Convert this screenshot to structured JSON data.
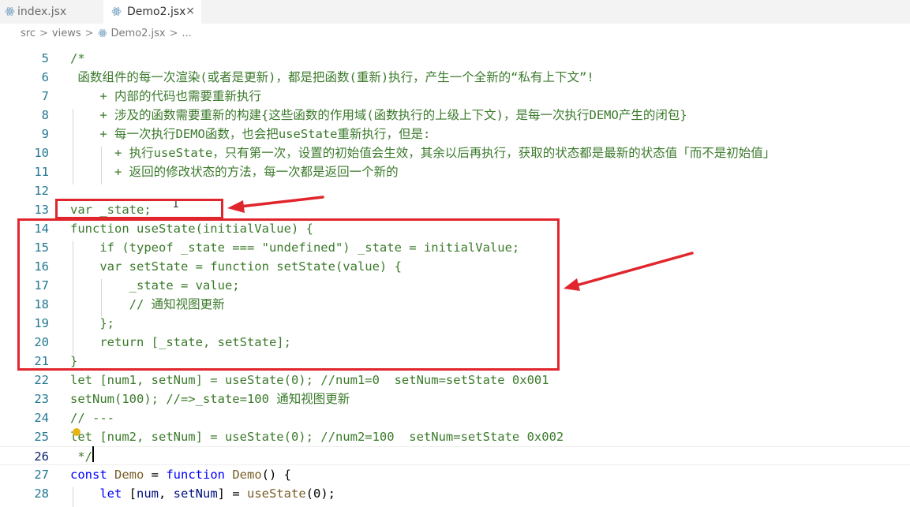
{
  "tabs": [
    {
      "label": "index.jsx",
      "active": false
    },
    {
      "label": "Demo2.jsx",
      "active": true,
      "close": "×"
    }
  ],
  "breadcrumb": {
    "items": [
      "src",
      "views",
      "Demo2.jsx",
      "..."
    ],
    "separator": ">"
  },
  "lines": [
    {
      "num": "5",
      "text": "/*"
    },
    {
      "num": "6",
      "text": " 函数组件的每一次渲染(或者是更新)，都是把函数(重新)执行，产生一个全新的“私有上下文”!"
    },
    {
      "num": "7",
      "text": "    + 内部的代码也需要重新执行"
    },
    {
      "num": "8",
      "text": "    + 涉及的函数需要重新的构建{这些函数的作用域(函数执行的上级上下文)，是每一次执行DEMO产生的闭包}"
    },
    {
      "num": "9",
      "text": "    + 每一次执行DEMO函数，也会把useState重新执行，但是:"
    },
    {
      "num": "10",
      "text": "      + 执行useState，只有第一次，设置的初始值会生效，其余以后再执行，获取的状态都是最新的状态值「而不是初始值」"
    },
    {
      "num": "11",
      "text": "      + 返回的修改状态的方法，每一次都是返回一个新的"
    },
    {
      "num": "12",
      "text": ""
    },
    {
      "num": "13",
      "text": "var _state;"
    },
    {
      "num": "14",
      "text": "function useState(initialValue) {"
    },
    {
      "num": "15",
      "text": "    if (typeof _state === \"undefined\") _state = initialValue;"
    },
    {
      "num": "16",
      "text": "    var setState = function setState(value) {"
    },
    {
      "num": "17",
      "text": "        _state = value;"
    },
    {
      "num": "18",
      "text": "        // 通知视图更新"
    },
    {
      "num": "19",
      "text": "    };"
    },
    {
      "num": "20",
      "text": "    return [_state, setState];"
    },
    {
      "num": "21",
      "text": "}"
    },
    {
      "num": "22",
      "text": "let [num1, setNum] = useState(0); //num1=0  setNum=setState 0x001"
    },
    {
      "num": "23",
      "text": "setNum(100); //=>_state=100 通知视图更新"
    },
    {
      "num": "24",
      "text": "// ---"
    },
    {
      "num": "25",
      "text": "let [num2, setNum] = useState(0); //num2=100  setNum=setState 0x002"
    },
    {
      "num": "26",
      "text": " */"
    }
  ],
  "line27": {
    "num": "27",
    "kw1": "const",
    "name": " Demo",
    "eq": " = ",
    "kw2": "function",
    "fn": " Demo",
    "rest": "() {"
  },
  "line28": {
    "num": "28",
    "indent": "    ",
    "kw": "let",
    "a": " [",
    "v1": "num",
    "c": ", ",
    "v2": "setNum",
    "b": "] = ",
    "fn": "useState",
    "rest": "(0);"
  },
  "colors": {
    "comment": "#3b7a2b",
    "keyword": "#0000ff",
    "function": "#795e26",
    "variable": "#001080",
    "annotation": "#e0262c"
  }
}
